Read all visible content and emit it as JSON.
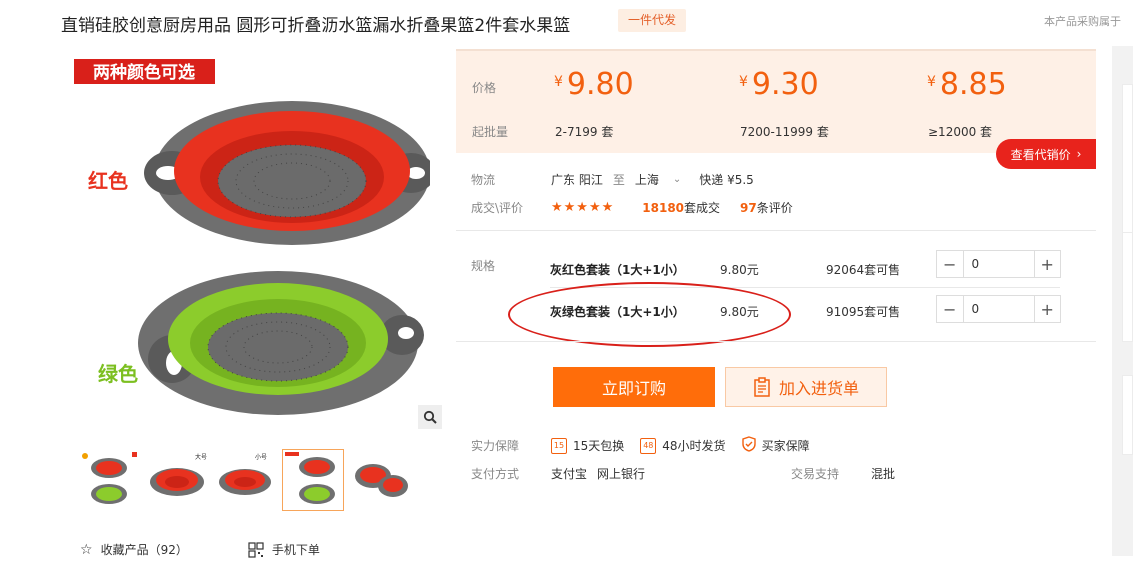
{
  "header": {
    "title": "直销硅胶创意厨房用品 圆形可折叠沥水篮漏水折叠果篮2件套水果篮",
    "dropship_tag": "一件代发",
    "right_note": "本产品采购属于"
  },
  "gallery": {
    "banner_text": "两种颜色可选",
    "red_label": "红色",
    "green_label": "绿色",
    "thumb_labels": [
      "大号",
      "小号"
    ],
    "favorite_label": "收藏产品（92）",
    "mobile_order_label": "手机下单"
  },
  "pricing": {
    "price_label": "价格",
    "min_batch_label": "起批量",
    "currency": "¥",
    "tiers": [
      {
        "price": "9.80",
        "range": "2-7199 套"
      },
      {
        "price": "9.30",
        "range": "7200-11999 套"
      },
      {
        "price": "8.85",
        "range": "≥12000 套"
      }
    ],
    "agent_price_button": "查看代销价"
  },
  "logistics": {
    "label": "物流",
    "origin": "广东 阳江",
    "to": "至",
    "destination": "上海",
    "express": "快递 ¥5.5"
  },
  "reviews": {
    "label": "成交\\评价",
    "stars": "★★★★★",
    "deals_count": "18180",
    "deals_suffix": "套成交",
    "review_count": "97",
    "review_suffix": "条评价"
  },
  "specs": {
    "label": "规格",
    "items": [
      {
        "name": "灰红色套装（1大+1小）",
        "price": "9.80元",
        "stock": "92064套可售",
        "qty": "0"
      },
      {
        "name": "灰绿色套装（1大+1小）",
        "price": "9.80元",
        "stock": "91095套可售",
        "qty": "0"
      }
    ]
  },
  "actions": {
    "buy_now": "立即订购",
    "add_to_list": "加入进货单"
  },
  "guarantee": {
    "label": "实力保障",
    "items": [
      "15天包换",
      "48小时发货",
      "买家保障"
    ],
    "icon_texts": [
      "15",
      "48"
    ]
  },
  "payment": {
    "label": "支付方式",
    "methods": [
      "支付宝",
      "网上银行"
    ],
    "trade_label": "交易支持",
    "trade_value": "混批"
  },
  "colors": {
    "accent": "#f2600f",
    "buy_button": "#ff6d0a",
    "price_bg": "#fef0e6",
    "agent_button": "#e8231c"
  }
}
